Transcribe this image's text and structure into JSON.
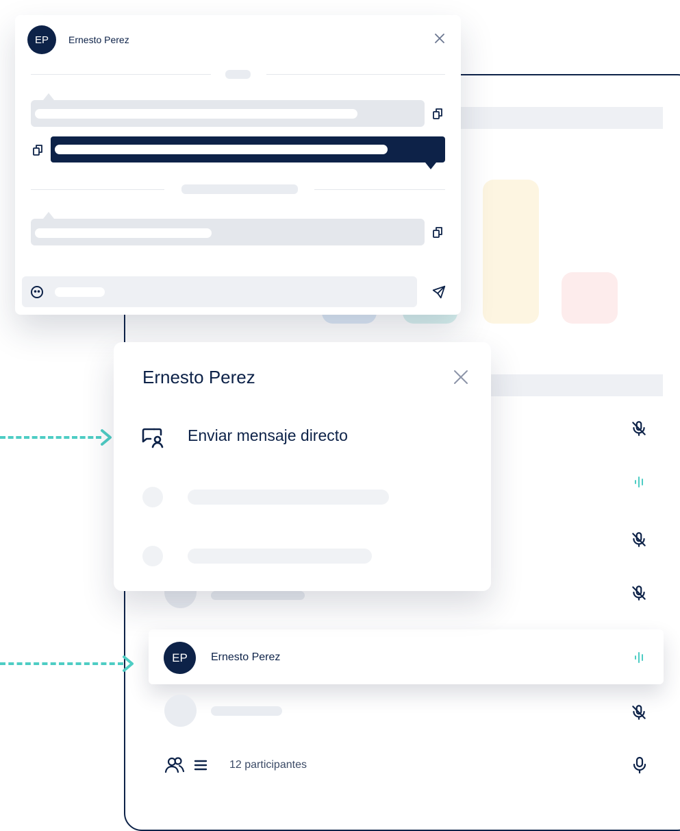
{
  "chat": {
    "avatar_initials": "EP",
    "contact_name": "Ernesto Perez",
    "close_icon": "close-icon",
    "copy_icon": "copy-icon",
    "emoji_icon": "emoji-icon",
    "send_icon": "send-icon"
  },
  "menu": {
    "title": "Ernesto Perez",
    "close_icon": "close-icon",
    "items": [
      {
        "label": "Enviar mensaje directo",
        "icon": "direct-message-icon"
      }
    ]
  },
  "participants": {
    "rows": [
      {
        "mic_state": "muted"
      },
      {
        "mic_state": "speaking"
      },
      {
        "mic_state": "muted"
      },
      {
        "mic_state": "muted"
      },
      {
        "initials": "EP",
        "name": "Ernesto Perez",
        "mic_state": "speaking"
      },
      {
        "mic_state": "muted"
      }
    ],
    "footer": {
      "count_label": "12 participantes",
      "people_icon": "people-icon",
      "list_icon": "list-icon",
      "mic_icon": "mic-icon"
    }
  },
  "colors": {
    "navy": "#0d2248",
    "teal": "#4ecdc4",
    "skeleton": "#e4e7ec",
    "tile_blue": "#dde9f6",
    "tile_teal": "#d8f1ef",
    "tile_yellow": "#fdf5e1",
    "tile_pink": "#fdecec"
  }
}
